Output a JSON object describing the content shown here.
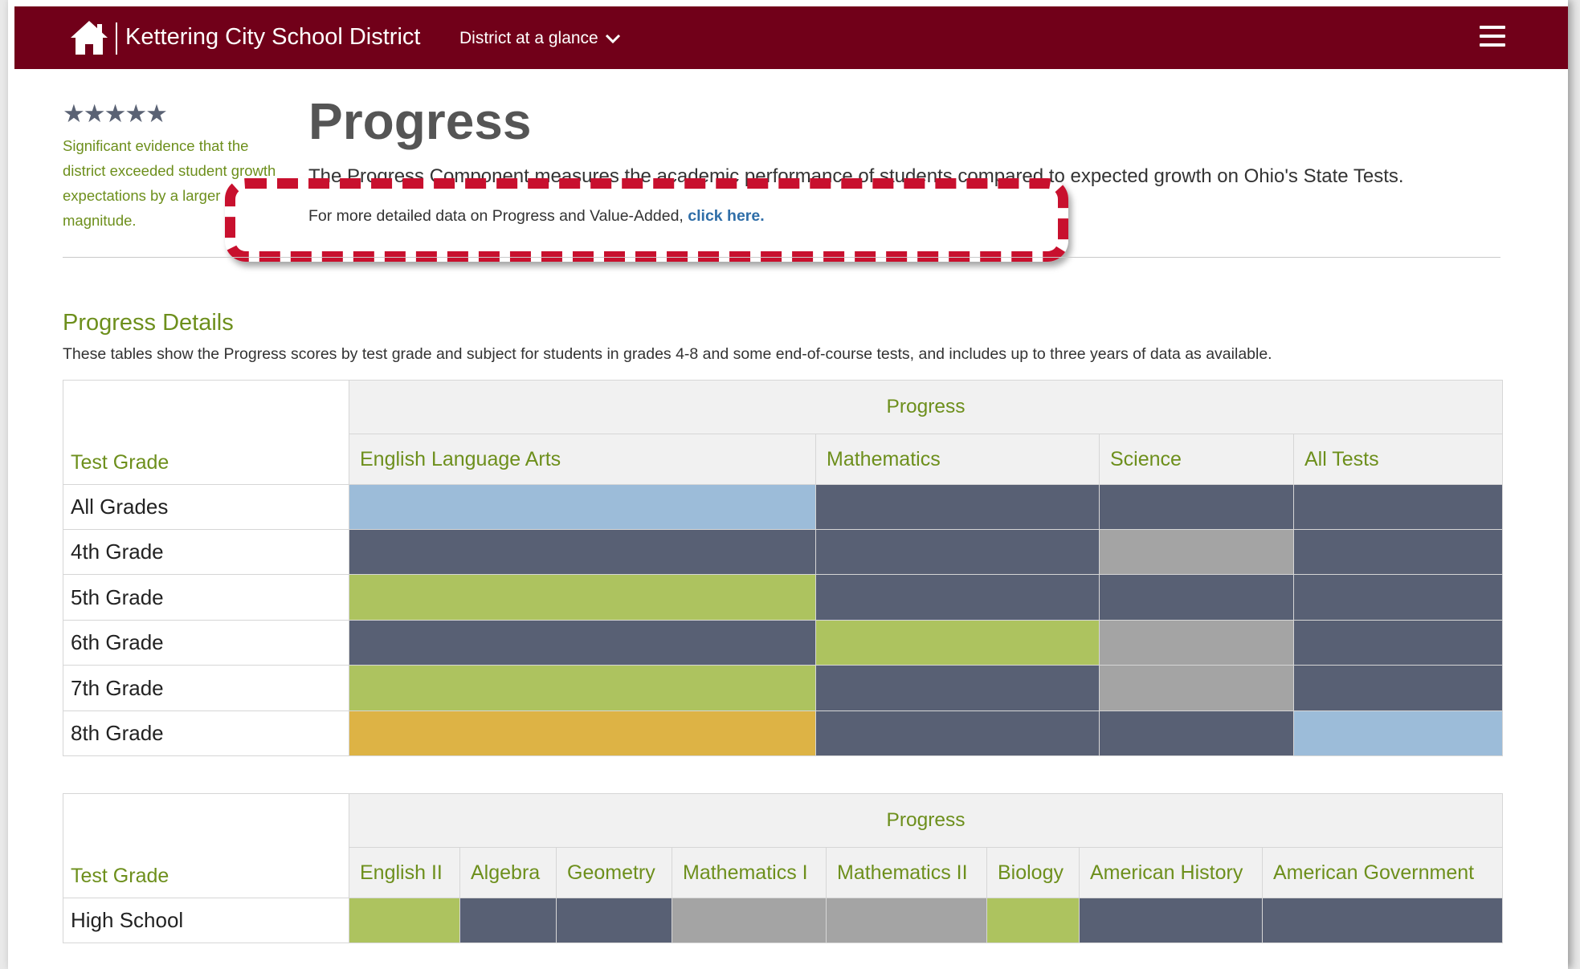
{
  "navbar": {
    "brand": "Kettering City School District",
    "dropdown_label": "District at a glance"
  },
  "rating": {
    "stars": "★★★★★",
    "description": "Significant evidence that the district exceeded student growth expectations by a larger magnitude."
  },
  "header": {
    "title": "Progress",
    "intro": "The Progress Component measures the academic performance of students compared to expected growth on Ohio's State Tests.",
    "more_prefix": "For more detailed data on Progress and Value-Added, ",
    "more_link": "click here."
  },
  "details": {
    "title": "Progress Details",
    "description": "These tables show the Progress scores by test grade and subject for students in grades 4-8 and some end-of-course tests, and includes up to three years of data as available."
  },
  "rating_colors": {
    "dark": "#586074",
    "light_blue": "#9cbcd9",
    "green": "#adc35f",
    "gray": "#a4a4a4",
    "gold": "#ddb345"
  },
  "tables": [
    {
      "corner_label": "Test Grade",
      "group_label": "Progress",
      "columns": [
        "English Language Arts",
        "Mathematics",
        "Science",
        "All Tests"
      ],
      "rows": [
        {
          "label": "All Grades",
          "cells": [
            "light_blue",
            "dark",
            "dark",
            "dark"
          ]
        },
        {
          "label": "4th Grade",
          "cells": [
            "dark",
            "dark",
            "gray",
            "dark"
          ]
        },
        {
          "label": "5th Grade",
          "cells": [
            "green",
            "dark",
            "dark",
            "dark"
          ]
        },
        {
          "label": "6th Grade",
          "cells": [
            "dark",
            "green",
            "gray",
            "dark"
          ]
        },
        {
          "label": "7th Grade",
          "cells": [
            "green",
            "dark",
            "gray",
            "dark"
          ]
        },
        {
          "label": "8th Grade",
          "cells": [
            "gold",
            "dark",
            "dark",
            "light_blue"
          ]
        }
      ]
    },
    {
      "corner_label": "Test Grade",
      "group_label": "Progress",
      "columns": [
        "English II",
        "Algebra",
        "Geometry",
        "Mathematics I",
        "Mathematics II",
        "Biology",
        "American History",
        "American Government"
      ],
      "rows": [
        {
          "label": "High School",
          "cells": [
            "green",
            "dark",
            "dark",
            "gray",
            "gray",
            "green",
            "dark",
            "dark"
          ]
        }
      ]
    }
  ]
}
